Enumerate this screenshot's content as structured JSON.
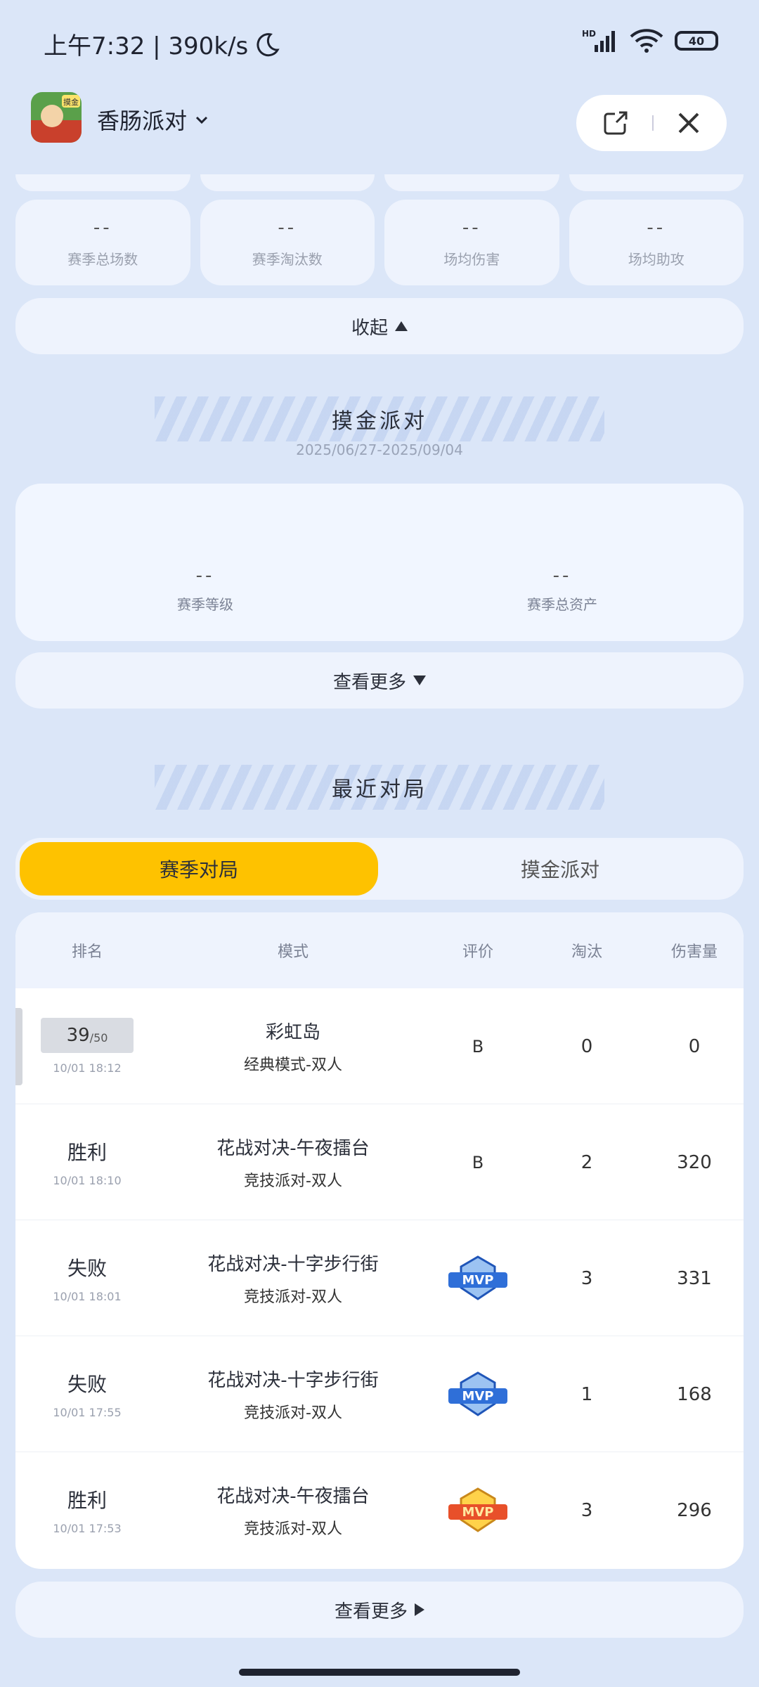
{
  "status": {
    "time_text": "上午7:32 | 390k/s",
    "network": "HD",
    "battery": "40"
  },
  "header": {
    "app_name": "香肠派对",
    "app_icon_badge": "摸金"
  },
  "stats": [
    {
      "value": "--",
      "label": "赛季总场数"
    },
    {
      "value": "--",
      "label": "赛季淘汰数"
    },
    {
      "value": "--",
      "label": "场均伤害"
    },
    {
      "value": "--",
      "label": "场均助攻"
    }
  ],
  "collapse_label": "收起",
  "season": {
    "title": "摸金派对",
    "range": "2025/06/27-2025/09/04",
    "level_value": "--",
    "level_label": "赛季等级",
    "assets_value": "--",
    "assets_label": "赛季总资产",
    "more_label": "查看更多"
  },
  "recent": {
    "title": "最近对局",
    "tabs": [
      "赛季对局",
      "摸金派对"
    ],
    "columns": [
      "排名",
      "模式",
      "评价",
      "淘汰",
      "伤害量"
    ],
    "rows": [
      {
        "rank": "39",
        "rank_total": "/50",
        "time": "10/01 18:12",
        "mode": "彩虹岛",
        "sub": "经典模式-双人",
        "eval": "B",
        "elim": "0",
        "dmg": "0"
      },
      {
        "rank": "胜利",
        "time": "10/01 18:10",
        "mode": "花战对决-午夜擂台",
        "sub": "竞技派对-双人",
        "eval": "B",
        "elim": "2",
        "dmg": "320"
      },
      {
        "rank": "失败",
        "time": "10/01 18:01",
        "mode": "花战对决-十字步行街",
        "sub": "竞技派对-双人",
        "eval": "MVP",
        "eval_color": "#2f6fd8",
        "elim": "3",
        "dmg": "331"
      },
      {
        "rank": "失败",
        "time": "10/01 17:55",
        "mode": "花战对决-十字步行街",
        "sub": "竞技派对-双人",
        "eval": "MVP",
        "eval_color": "#2f6fd8",
        "elim": "1",
        "dmg": "168"
      },
      {
        "rank": "胜利",
        "time": "10/01 17:53",
        "mode": "花战对决-午夜擂台",
        "sub": "竞技派对-双人",
        "eval": "MVP",
        "eval_color": "#e8502a",
        "elim": "3",
        "dmg": "296"
      }
    ],
    "more_label": "查看更多"
  },
  "colors": {
    "background": "#dbe6f8",
    "active_tab": "#fec200",
    "mvp_blue": "#2f6fd8",
    "mvp_gold": "#e8502a"
  }
}
